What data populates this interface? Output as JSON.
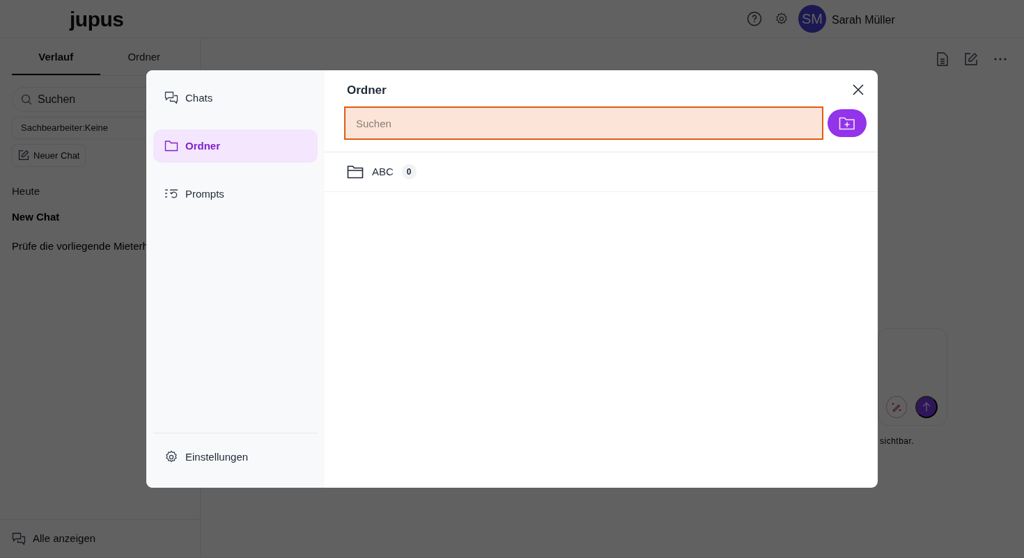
{
  "header": {
    "logo": "jupus",
    "user": {
      "initials": "SM",
      "name": "Sarah Müller"
    }
  },
  "sidebar": {
    "tabs": [
      {
        "label": "Verlauf",
        "selected": true
      },
      {
        "label": "Ordner",
        "selected": false
      }
    ],
    "search": {
      "placeholder": "Suchen"
    },
    "filter": {
      "label": "Sachbearbeiter:",
      "value": "Keine"
    },
    "new_chat": "Neuer Chat",
    "groups": [
      {
        "label": "Heute",
        "chats": [
          {
            "title": "New Chat",
            "selected": true
          },
          {
            "title": "Prüfe die vorliegende Mieterh",
            "selected": false
          }
        ]
      }
    ],
    "footer": "Alle anzeigen"
  },
  "composer": {
    "note": "sichtbar."
  },
  "modal": {
    "nav": [
      {
        "label": "Chats",
        "kind": "chats",
        "selected": false
      },
      {
        "label": "Ordner",
        "kind": "folder",
        "selected": true
      },
      {
        "label": "Prompts",
        "kind": "prompts",
        "selected": false
      }
    ],
    "settings": "Einstellungen",
    "title": "Ordner",
    "search": {
      "placeholder": "Suchen",
      "focused": true
    },
    "folders": [
      {
        "name": "ABC",
        "count": "0"
      }
    ]
  }
}
